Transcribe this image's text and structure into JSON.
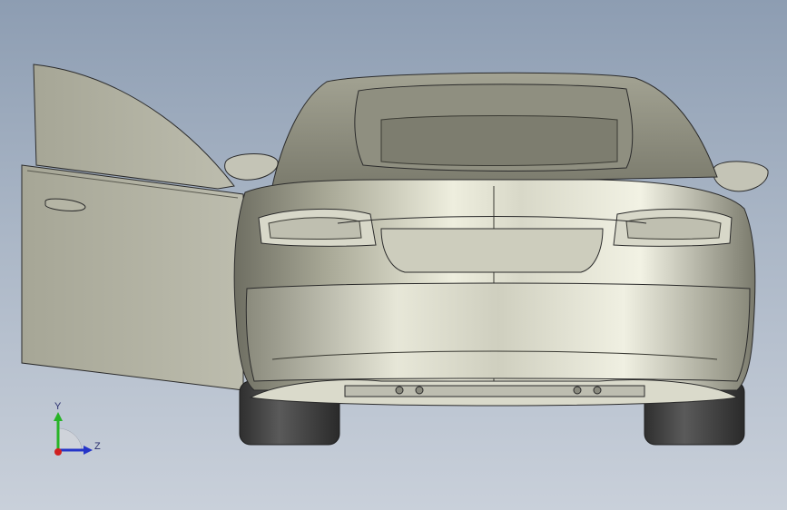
{
  "viewport": {
    "background_top": "#8d9db2",
    "background_bottom": "#c9d0da",
    "model_body_color": "#c4c4b5",
    "model_edge_color": "#2b2b2b",
    "tire_color": "#3a3a3a"
  },
  "triad": {
    "y_label": "Y",
    "z_label": "Z",
    "y_axis_color": "#27b427",
    "z_axis_color": "#2535c8",
    "x_axis_color": "#d02020"
  }
}
